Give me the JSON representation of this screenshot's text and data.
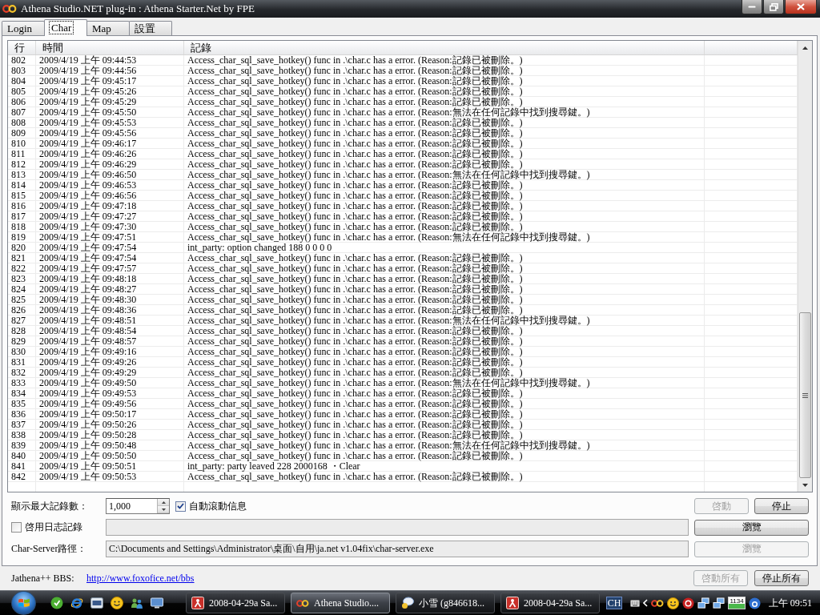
{
  "window": {
    "title": "Athena Studio.NET plug-in : Athena Starter.Net by FPE"
  },
  "tabs": [
    {
      "label": "Login",
      "selected": false
    },
    {
      "label": "Char",
      "selected": true
    },
    {
      "label": "Map",
      "selected": false
    },
    {
      "label": "設置",
      "selected": false
    }
  ],
  "log_table": {
    "columns": [
      "行",
      "時間",
      "記錄"
    ],
    "rows": [
      {
        "line": "802",
        "time": "2009/4/19 上午 09:44:53",
        "message": "Access_char_sql_save_hotkey() func in .\\char.c has a error. (Reason:記錄已被刪除。)"
      },
      {
        "line": "803",
        "time": "2009/4/19 上午 09:44:56",
        "message": "Access_char_sql_save_hotkey() func in .\\char.c has a error. (Reason:記錄已被刪除。)"
      },
      {
        "line": "804",
        "time": "2009/4/19 上午 09:45:17",
        "message": "Access_char_sql_save_hotkey() func in .\\char.c has a error. (Reason:記錄已被刪除。)"
      },
      {
        "line": "805",
        "time": "2009/4/19 上午 09:45:26",
        "message": "Access_char_sql_save_hotkey() func in .\\char.c has a error. (Reason:記錄已被刪除。)"
      },
      {
        "line": "806",
        "time": "2009/4/19 上午 09:45:29",
        "message": "Access_char_sql_save_hotkey() func in .\\char.c has a error. (Reason:記錄已被刪除。)"
      },
      {
        "line": "807",
        "time": "2009/4/19 上午 09:45:50",
        "message": "Access_char_sql_save_hotkey() func in .\\char.c has a error. (Reason:無法在任何記錄中找到搜尋鍵。)"
      },
      {
        "line": "808",
        "time": "2009/4/19 上午 09:45:53",
        "message": "Access_char_sql_save_hotkey() func in .\\char.c has a error. (Reason:記錄已被刪除。)"
      },
      {
        "line": "809",
        "time": "2009/4/19 上午 09:45:56",
        "message": "Access_char_sql_save_hotkey() func in .\\char.c has a error. (Reason:記錄已被刪除。)"
      },
      {
        "line": "810",
        "time": "2009/4/19 上午 09:46:17",
        "message": "Access_char_sql_save_hotkey() func in .\\char.c has a error. (Reason:記錄已被刪除。)"
      },
      {
        "line": "811",
        "time": "2009/4/19 上午 09:46:26",
        "message": "Access_char_sql_save_hotkey() func in .\\char.c has a error. (Reason:記錄已被刪除。)"
      },
      {
        "line": "812",
        "time": "2009/4/19 上午 09:46:29",
        "message": "Access_char_sql_save_hotkey() func in .\\char.c has a error. (Reason:記錄已被刪除。)"
      },
      {
        "line": "813",
        "time": "2009/4/19 上午 09:46:50",
        "message": "Access_char_sql_save_hotkey() func in .\\char.c has a error. (Reason:無法在任何記錄中找到搜尋鍵。)"
      },
      {
        "line": "814",
        "time": "2009/4/19 上午 09:46:53",
        "message": "Access_char_sql_save_hotkey() func in .\\char.c has a error. (Reason:記錄已被刪除。)"
      },
      {
        "line": "815",
        "time": "2009/4/19 上午 09:46:56",
        "message": "Access_char_sql_save_hotkey() func in .\\char.c has a error. (Reason:記錄已被刪除。)"
      },
      {
        "line": "816",
        "time": "2009/4/19 上午 09:47:18",
        "message": "Access_char_sql_save_hotkey() func in .\\char.c has a error. (Reason:記錄已被刪除。)"
      },
      {
        "line": "817",
        "time": "2009/4/19 上午 09:47:27",
        "message": "Access_char_sql_save_hotkey() func in .\\char.c has a error. (Reason:記錄已被刪除。)"
      },
      {
        "line": "818",
        "time": "2009/4/19 上午 09:47:30",
        "message": "Access_char_sql_save_hotkey() func in .\\char.c has a error. (Reason:記錄已被刪除。)"
      },
      {
        "line": "819",
        "time": "2009/4/19 上午 09:47:51",
        "message": "Access_char_sql_save_hotkey() func in .\\char.c has a error. (Reason:無法在任何記錄中找到搜尋鍵。)"
      },
      {
        "line": "820",
        "time": "2009/4/19 上午 09:47:54",
        "message": "int_party: option changed 188 0 0 0 0"
      },
      {
        "line": "821",
        "time": "2009/4/19 上午 09:47:54",
        "message": "Access_char_sql_save_hotkey() func in .\\char.c has a error. (Reason:記錄已被刪除。)"
      },
      {
        "line": "822",
        "time": "2009/4/19 上午 09:47:57",
        "message": "Access_char_sql_save_hotkey() func in .\\char.c has a error. (Reason:記錄已被刪除。)"
      },
      {
        "line": "823",
        "time": "2009/4/19 上午 09:48:18",
        "message": "Access_char_sql_save_hotkey() func in .\\char.c has a error. (Reason:記錄已被刪除。)"
      },
      {
        "line": "824",
        "time": "2009/4/19 上午 09:48:27",
        "message": "Access_char_sql_save_hotkey() func in .\\char.c has a error. (Reason:記錄已被刪除。)"
      },
      {
        "line": "825",
        "time": "2009/4/19 上午 09:48:30",
        "message": "Access_char_sql_save_hotkey() func in .\\char.c has a error. (Reason:記錄已被刪除。)"
      },
      {
        "line": "826",
        "time": "2009/4/19 上午 09:48:36",
        "message": "Access_char_sql_save_hotkey() func in .\\char.c has a error. (Reason:記錄已被刪除。)"
      },
      {
        "line": "827",
        "time": "2009/4/19 上午 09:48:51",
        "message": "Access_char_sql_save_hotkey() func in .\\char.c has a error. (Reason:無法在任何記錄中找到搜尋鍵。)"
      },
      {
        "line": "828",
        "time": "2009/4/19 上午 09:48:54",
        "message": "Access_char_sql_save_hotkey() func in .\\char.c has a error. (Reason:記錄已被刪除。)"
      },
      {
        "line": "829",
        "time": "2009/4/19 上午 09:48:57",
        "message": "Access_char_sql_save_hotkey() func in .\\char.c has a error. (Reason:記錄已被刪除。)"
      },
      {
        "line": "830",
        "time": "2009/4/19 上午 09:49:16",
        "message": "Access_char_sql_save_hotkey() func in .\\char.c has a error. (Reason:記錄已被刪除。)"
      },
      {
        "line": "831",
        "time": "2009/4/19 上午 09:49:26",
        "message": "Access_char_sql_save_hotkey() func in .\\char.c has a error. (Reason:記錄已被刪除。)"
      },
      {
        "line": "832",
        "time": "2009/4/19 上午 09:49:29",
        "message": "Access_char_sql_save_hotkey() func in .\\char.c has a error. (Reason:記錄已被刪除。)"
      },
      {
        "line": "833",
        "time": "2009/4/19 上午 09:49:50",
        "message": "Access_char_sql_save_hotkey() func in .\\char.c has a error. (Reason:無法在任何記錄中找到搜尋鍵。)"
      },
      {
        "line": "834",
        "time": "2009/4/19 上午 09:49:53",
        "message": "Access_char_sql_save_hotkey() func in .\\char.c has a error. (Reason:記錄已被刪除。)"
      },
      {
        "line": "835",
        "time": "2009/4/19 上午 09:49:56",
        "message": "Access_char_sql_save_hotkey() func in .\\char.c has a error. (Reason:記錄已被刪除。)"
      },
      {
        "line": "836",
        "time": "2009/4/19 上午 09:50:17",
        "message": "Access_char_sql_save_hotkey() func in .\\char.c has a error. (Reason:記錄已被刪除。)"
      },
      {
        "line": "837",
        "time": "2009/4/19 上午 09:50:26",
        "message": "Access_char_sql_save_hotkey() func in .\\char.c has a error. (Reason:記錄已被刪除。)"
      },
      {
        "line": "838",
        "time": "2009/4/19 上午 09:50:28",
        "message": "Access_char_sql_save_hotkey() func in .\\char.c has a error. (Reason:記錄已被刪除。)"
      },
      {
        "line": "839",
        "time": "2009/4/19 上午 09:50:48",
        "message": "Access_char_sql_save_hotkey() func in .\\char.c has a error. (Reason:無法在任何記錄中找到搜尋鍵。)"
      },
      {
        "line": "840",
        "time": "2009/4/19 上午 09:50:50",
        "message": "Access_char_sql_save_hotkey() func in .\\char.c has a error. (Reason:記錄已被刪除。)"
      },
      {
        "line": "841",
        "time": "2009/4/19 上午 09:50:51",
        "message": "int_party: party leaved 228 2000168 ・Clear"
      },
      {
        "line": "842",
        "time": "2009/4/19 上午 09:50:53",
        "message": "Access_char_sql_save_hotkey() func in .\\char.c has a error. (Reason:記錄已被刪除。)"
      }
    ]
  },
  "options": {
    "max_records": {
      "label": "顯示最大記錄數：",
      "value": "1,000"
    },
    "auto_scroll": {
      "label": "自動滾動信息",
      "checked": true
    },
    "start_button": {
      "label": "啓動",
      "disabled": true
    },
    "stop_button": {
      "label": "停止",
      "disabled": false
    },
    "enable_log": {
      "label": "啓用日志記錄",
      "checked": false
    },
    "browse_log_button": {
      "label": "瀏覽",
      "disabled": false
    },
    "server_path": {
      "label": "Char-Server路徑：",
      "value": "C:\\Documents and Settings\\Administrator\\桌面\\自用\\ja.net v1.04fix\\char-server.exe"
    },
    "browse_server_button": {
      "label": "瀏覽",
      "disabled": true
    }
  },
  "footer": {
    "bbs_label": "Jathena++ BBS:",
    "bbs_link": "http://www.foxofice.net/bbs",
    "buttons": [
      {
        "label": "啓動所有",
        "disabled": true
      },
      {
        "label": "停止所有",
        "disabled": false
      }
    ]
  },
  "taskbar": {
    "tasks": [
      {
        "label": "2008-04-29a Sa...",
        "kind": "tile",
        "selected": false
      },
      {
        "label": "Athena Studio....",
        "kind": "rings",
        "selected": true
      },
      {
        "label": "小雪 (g846618...",
        "kind": "chat",
        "selected": false
      },
      {
        "label": "2008-04-29a Sa...",
        "kind": "tile",
        "selected": false
      }
    ],
    "tray": {
      "input_language": "CH",
      "counter": "1134",
      "clock": "上午 09:51"
    }
  }
}
